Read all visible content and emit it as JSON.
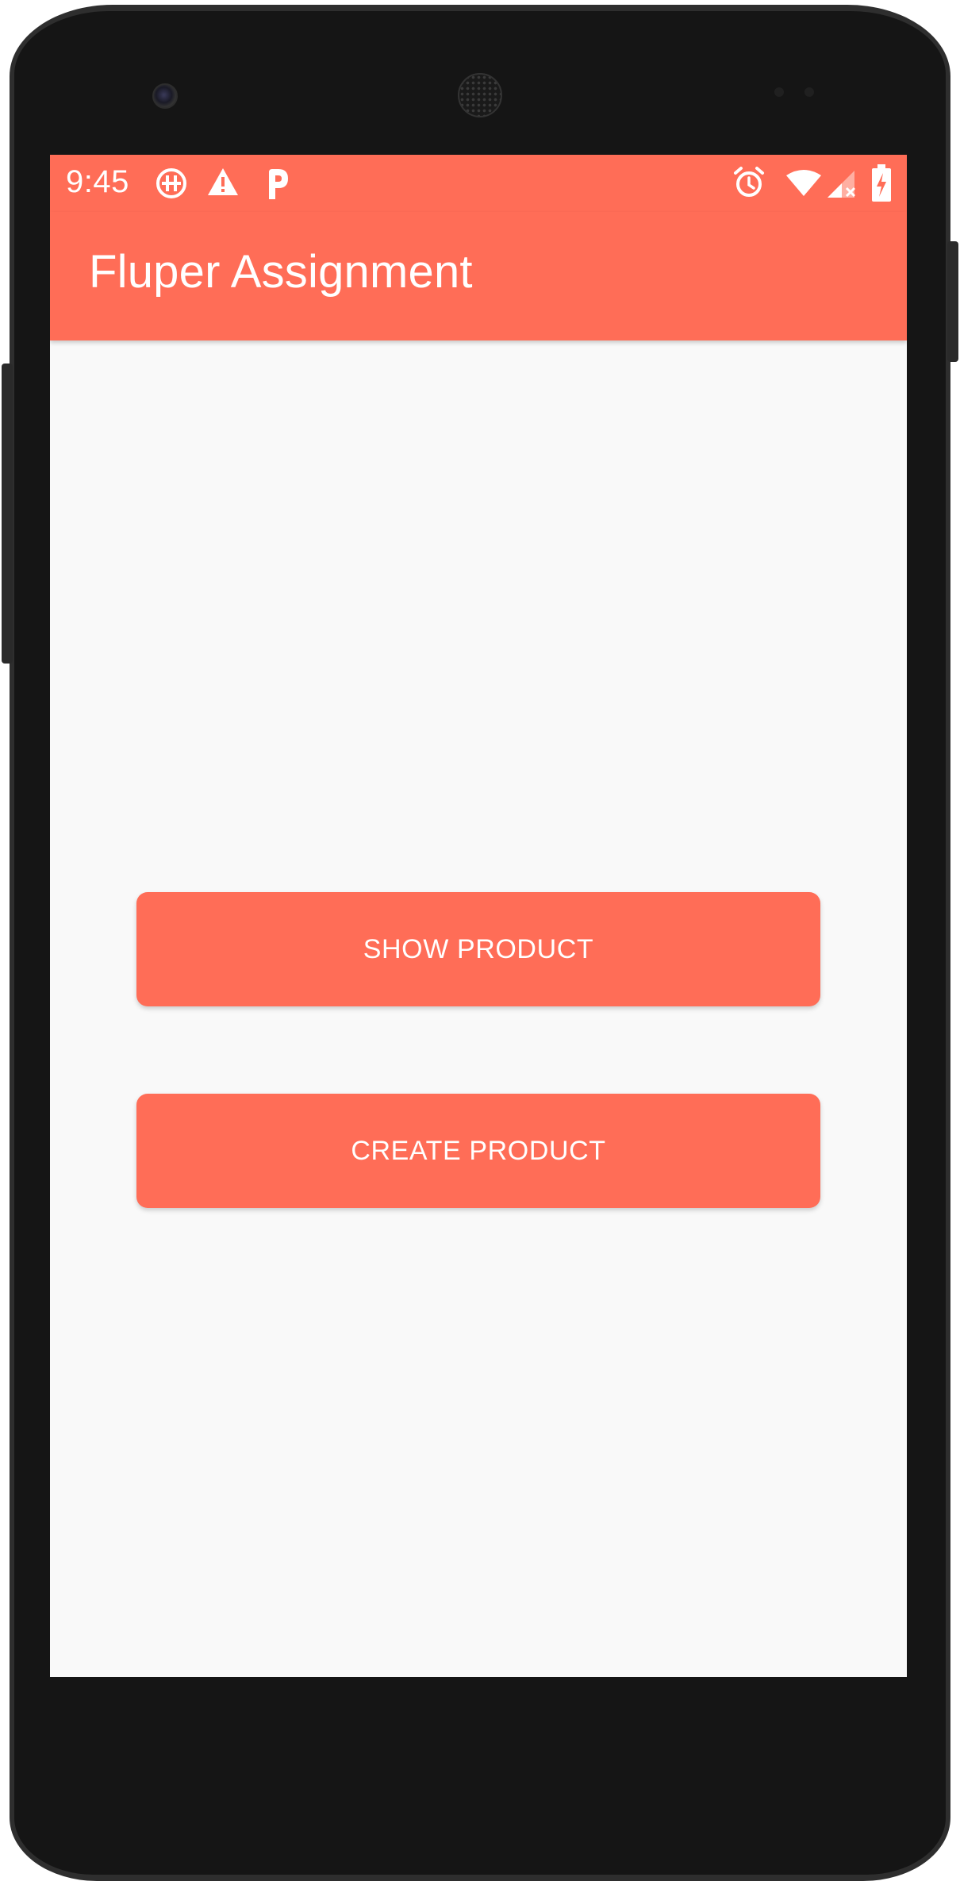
{
  "status_bar": {
    "time": "9:45",
    "left_icons": [
      "hippo-app-icon",
      "warning-icon",
      "parking-app-icon"
    ],
    "right_icons": [
      "alarm-clock-icon",
      "wifi-icon",
      "cell-signal-no-service-icon",
      "battery-charging-icon"
    ]
  },
  "app_bar": {
    "title": "Fluper Assignment"
  },
  "main": {
    "show_product_label": "SHOW PRODUCT",
    "create_product_label": "CREATE PRODUCT"
  },
  "colors": {
    "accent": "#ff6d57",
    "background": "#f9f9f9",
    "on_accent_text": "#ffffff",
    "device_body": "#151515"
  }
}
